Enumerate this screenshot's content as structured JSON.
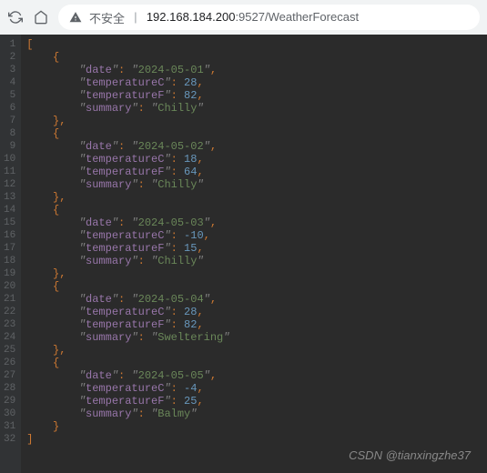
{
  "browser": {
    "security_text": "不安全",
    "url_host": "192.168.184.200",
    "url_port": ":9527",
    "url_path": "/WeatherForecast"
  },
  "watermark": "CSDN @tianxingzhe37",
  "chart_data": {
    "type": "table",
    "title": "WeatherForecast JSON response",
    "columns": [
      "date",
      "temperatureC",
      "temperatureF",
      "summary"
    ],
    "rows": [
      {
        "date": "2024-05-01",
        "temperatureC": 28,
        "temperatureF": 82,
        "summary": "Chilly"
      },
      {
        "date": "2024-05-02",
        "temperatureC": 18,
        "temperatureF": 64,
        "summary": "Chilly"
      },
      {
        "date": "2024-05-03",
        "temperatureC": -10,
        "temperatureF": 15,
        "summary": "Chilly"
      },
      {
        "date": "2024-05-04",
        "temperatureC": 28,
        "temperatureF": 82,
        "summary": "Sweltering"
      },
      {
        "date": "2024-05-05",
        "temperatureC": -4,
        "temperatureF": 25,
        "summary": "Balmy"
      }
    ]
  },
  "code_lines": [
    {
      "indent": 0,
      "type": "open-array"
    },
    {
      "indent": 1,
      "type": "open-obj"
    },
    {
      "indent": 2,
      "type": "kv",
      "key": "date",
      "val": "2024-05-01",
      "vtype": "str",
      "comma": true
    },
    {
      "indent": 2,
      "type": "kv",
      "key": "temperatureC",
      "val": "28",
      "vtype": "num",
      "comma": true
    },
    {
      "indent": 2,
      "type": "kv",
      "key": "temperatureF",
      "val": "82",
      "vtype": "num",
      "comma": true
    },
    {
      "indent": 2,
      "type": "kv",
      "key": "summary",
      "val": "Chilly",
      "vtype": "str",
      "comma": false
    },
    {
      "indent": 1,
      "type": "close-obj",
      "comma": true
    },
    {
      "indent": 1,
      "type": "open-obj"
    },
    {
      "indent": 2,
      "type": "kv",
      "key": "date",
      "val": "2024-05-02",
      "vtype": "str",
      "comma": true
    },
    {
      "indent": 2,
      "type": "kv",
      "key": "temperatureC",
      "val": "18",
      "vtype": "num",
      "comma": true
    },
    {
      "indent": 2,
      "type": "kv",
      "key": "temperatureF",
      "val": "64",
      "vtype": "num",
      "comma": true
    },
    {
      "indent": 2,
      "type": "kv",
      "key": "summary",
      "val": "Chilly",
      "vtype": "str",
      "comma": false
    },
    {
      "indent": 1,
      "type": "close-obj",
      "comma": true
    },
    {
      "indent": 1,
      "type": "open-obj"
    },
    {
      "indent": 2,
      "type": "kv",
      "key": "date",
      "val": "2024-05-03",
      "vtype": "str",
      "comma": true
    },
    {
      "indent": 2,
      "type": "kv",
      "key": "temperatureC",
      "val": "-10",
      "vtype": "num",
      "comma": true
    },
    {
      "indent": 2,
      "type": "kv",
      "key": "temperatureF",
      "val": "15",
      "vtype": "num",
      "comma": true
    },
    {
      "indent": 2,
      "type": "kv",
      "key": "summary",
      "val": "Chilly",
      "vtype": "str",
      "comma": false
    },
    {
      "indent": 1,
      "type": "close-obj",
      "comma": true
    },
    {
      "indent": 1,
      "type": "open-obj"
    },
    {
      "indent": 2,
      "type": "kv",
      "key": "date",
      "val": "2024-05-04",
      "vtype": "str",
      "comma": true
    },
    {
      "indent": 2,
      "type": "kv",
      "key": "temperatureC",
      "val": "28",
      "vtype": "num",
      "comma": true
    },
    {
      "indent": 2,
      "type": "kv",
      "key": "temperatureF",
      "val": "82",
      "vtype": "num",
      "comma": true
    },
    {
      "indent": 2,
      "type": "kv",
      "key": "summary",
      "val": "Sweltering",
      "vtype": "str",
      "comma": false
    },
    {
      "indent": 1,
      "type": "close-obj",
      "comma": true
    },
    {
      "indent": 1,
      "type": "open-obj"
    },
    {
      "indent": 2,
      "type": "kv",
      "key": "date",
      "val": "2024-05-05",
      "vtype": "str",
      "comma": true
    },
    {
      "indent": 2,
      "type": "kv",
      "key": "temperatureC",
      "val": "-4",
      "vtype": "num",
      "comma": true
    },
    {
      "indent": 2,
      "type": "kv",
      "key": "temperatureF",
      "val": "25",
      "vtype": "num",
      "comma": true
    },
    {
      "indent": 2,
      "type": "kv",
      "key": "summary",
      "val": "Balmy",
      "vtype": "str",
      "comma": false
    },
    {
      "indent": 1,
      "type": "close-obj",
      "comma": false
    },
    {
      "indent": 0,
      "type": "close-array"
    }
  ]
}
